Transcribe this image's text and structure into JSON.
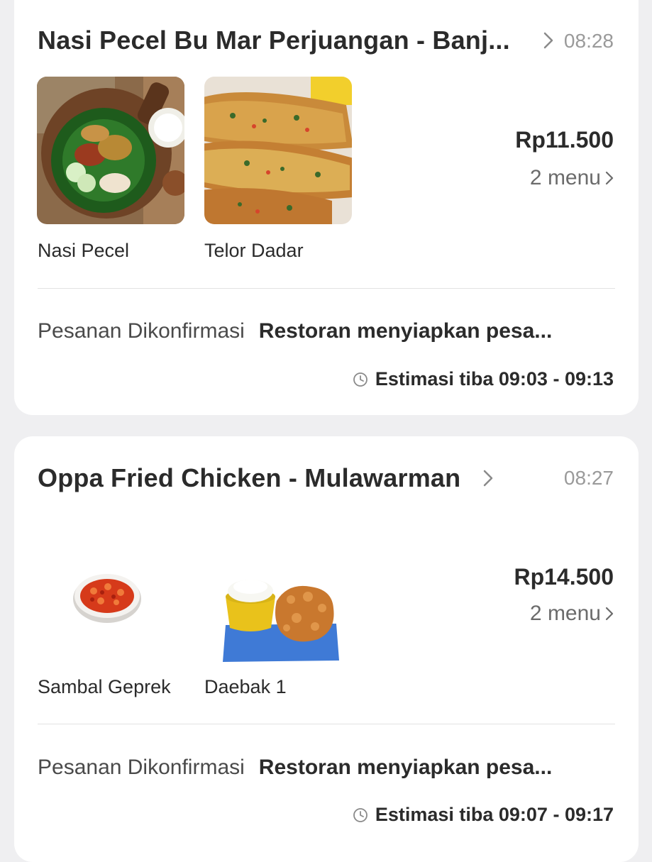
{
  "orders": [
    {
      "restaurant": "Nasi Pecel Bu Mar Perjuangan - Banj...",
      "time": "08:28",
      "items": [
        {
          "name": "Nasi Pecel",
          "image": "nasi-pecel-photo"
        },
        {
          "name": "Telor Dadar",
          "image": "telor-dadar-photo"
        }
      ],
      "price": "Rp11.500",
      "menu_count": "2 menu",
      "status_label": "Pesanan Dikonfirmasi",
      "status_desc": "Restoran menyiapkan pesa...",
      "eta": "Estimasi tiba 09:03 - 09:13"
    },
    {
      "restaurant": "Oppa Fried Chicken - Mulawarman",
      "time": "08:27",
      "items": [
        {
          "name": "Sambal Geprek",
          "image": "sambal-geprek-photo"
        },
        {
          "name": "Daebak 1",
          "image": "daebak-photo"
        }
      ],
      "price": "Rp14.500",
      "menu_count": "2 menu",
      "status_label": "Pesanan Dikonfirmasi",
      "status_desc": "Restoran menyiapkan pesa...",
      "eta": "Estimasi tiba 09:07 - 09:17"
    }
  ],
  "icons": {
    "chevron": "chevron-right-icon",
    "clock": "clock-icon"
  },
  "colors": {
    "background": "#efeff1",
    "card": "#ffffff",
    "text": "#2b2b2b",
    "muted": "#9a9a9a"
  }
}
